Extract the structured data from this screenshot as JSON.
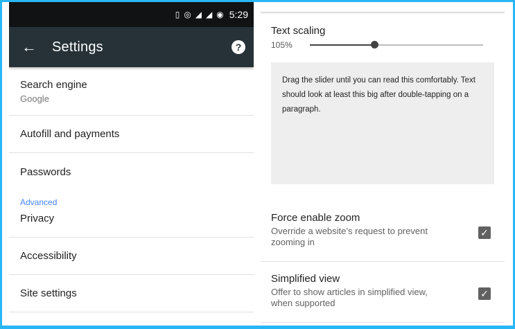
{
  "status_bar": {
    "time": "5:29",
    "icons": [
      "vibrate-icon",
      "hotspot-icon",
      "lte-signal-icon",
      "signal-icon",
      "alarm-icon"
    ]
  },
  "toolbar": {
    "back_glyph": "←",
    "title": "Settings",
    "help_glyph": "?"
  },
  "settings": {
    "search_engine": {
      "label": "Search engine",
      "value": "Google"
    },
    "autofill": "Autofill and payments",
    "passwords": "Passwords",
    "section_advanced": "Advanced",
    "privacy": "Privacy",
    "accessibility": "Accessibility",
    "site_settings": "Site settings"
  },
  "accessibility": {
    "text_scaling": {
      "label": "Text scaling",
      "value_text": "105%",
      "slider_fraction": 0.37
    },
    "preview_text": "Drag the slider until you can read this comfortably. Text should look at least this big after double-tapping on a paragraph.",
    "force_zoom": {
      "title": "Force enable zoom",
      "desc": "Override a website’s request to prevent zooming in",
      "checked": true
    },
    "simplified_view": {
      "title": "Simplified view",
      "desc": "Offer to show articles in simplified view, when supported",
      "checked": true
    }
  },
  "colors": {
    "toolbar": "#263238",
    "status_bar": "#111214",
    "accent": "#4285f4",
    "frame": "#29b6f6"
  }
}
